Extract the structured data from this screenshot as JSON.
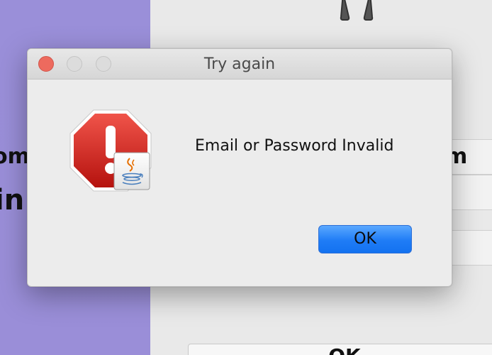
{
  "background": {
    "text_fragment_left_1": "om",
    "text_fragment_left_2": "in",
    "text_fragment_right": "m",
    "bottom_button_label": "OK"
  },
  "dialog": {
    "title": "Try again",
    "message": "Email or Password Invalid",
    "ok_label": "OK",
    "icon": "stop-alert-java-icon"
  },
  "colors": {
    "sidebar_purple": "#9a8fd9",
    "close_red": "#ed6a5e",
    "ok_blue": "#1f7cf6"
  }
}
